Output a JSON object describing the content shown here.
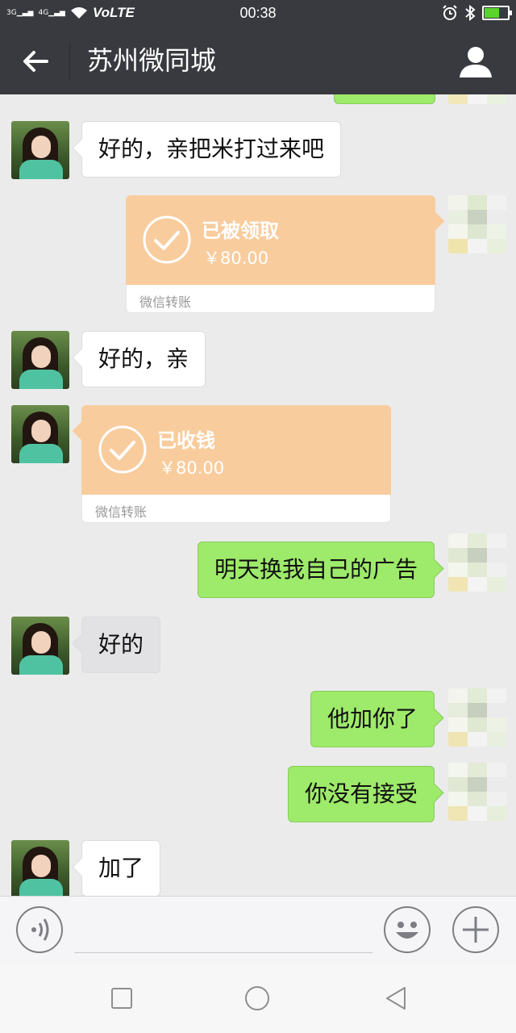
{
  "status_bar": {
    "signal_1": "3G",
    "signal_2": "4G",
    "network": "VoLTE",
    "time": "00:38",
    "icons": [
      "alarm-icon",
      "bluetooth-icon",
      "battery-icon"
    ]
  },
  "header": {
    "title": "苏州微同城",
    "back_icon": "back-arrow-icon",
    "profile_icon": "person-icon"
  },
  "messages": [
    {
      "side": "left",
      "type": "text",
      "text": "好的，亲把米打过来吧"
    },
    {
      "side": "right",
      "type": "transfer",
      "status": "已被领取",
      "amount": "￥80.00",
      "footer": "微信转账"
    },
    {
      "side": "left",
      "type": "text",
      "text": "好的，亲"
    },
    {
      "side": "left",
      "type": "transfer",
      "status": "已收钱",
      "amount": "￥80.00",
      "footer": "微信转账"
    },
    {
      "side": "right",
      "type": "text",
      "text": "明天换我自己的广告"
    },
    {
      "side": "left",
      "type": "text",
      "text": "好的"
    },
    {
      "side": "right",
      "type": "text",
      "text": "他加你了"
    },
    {
      "side": "right",
      "type": "text",
      "text": "你没有接受"
    },
    {
      "side": "left",
      "type": "text",
      "text": "加了"
    }
  ],
  "input_bar": {
    "voice_icon": "voice-icon",
    "emoji_icon": "emoji-icon",
    "plus_icon": "plus-icon",
    "input_value": ""
  },
  "nav_bar": {
    "icons": [
      "recent-apps-icon",
      "home-icon",
      "back-icon"
    ]
  },
  "colors": {
    "header_bg": "#393a3f",
    "chat_bg": "#ebebeb",
    "my_bubble": "#9eea6a",
    "transfer_bg": "#f9cc9d"
  }
}
